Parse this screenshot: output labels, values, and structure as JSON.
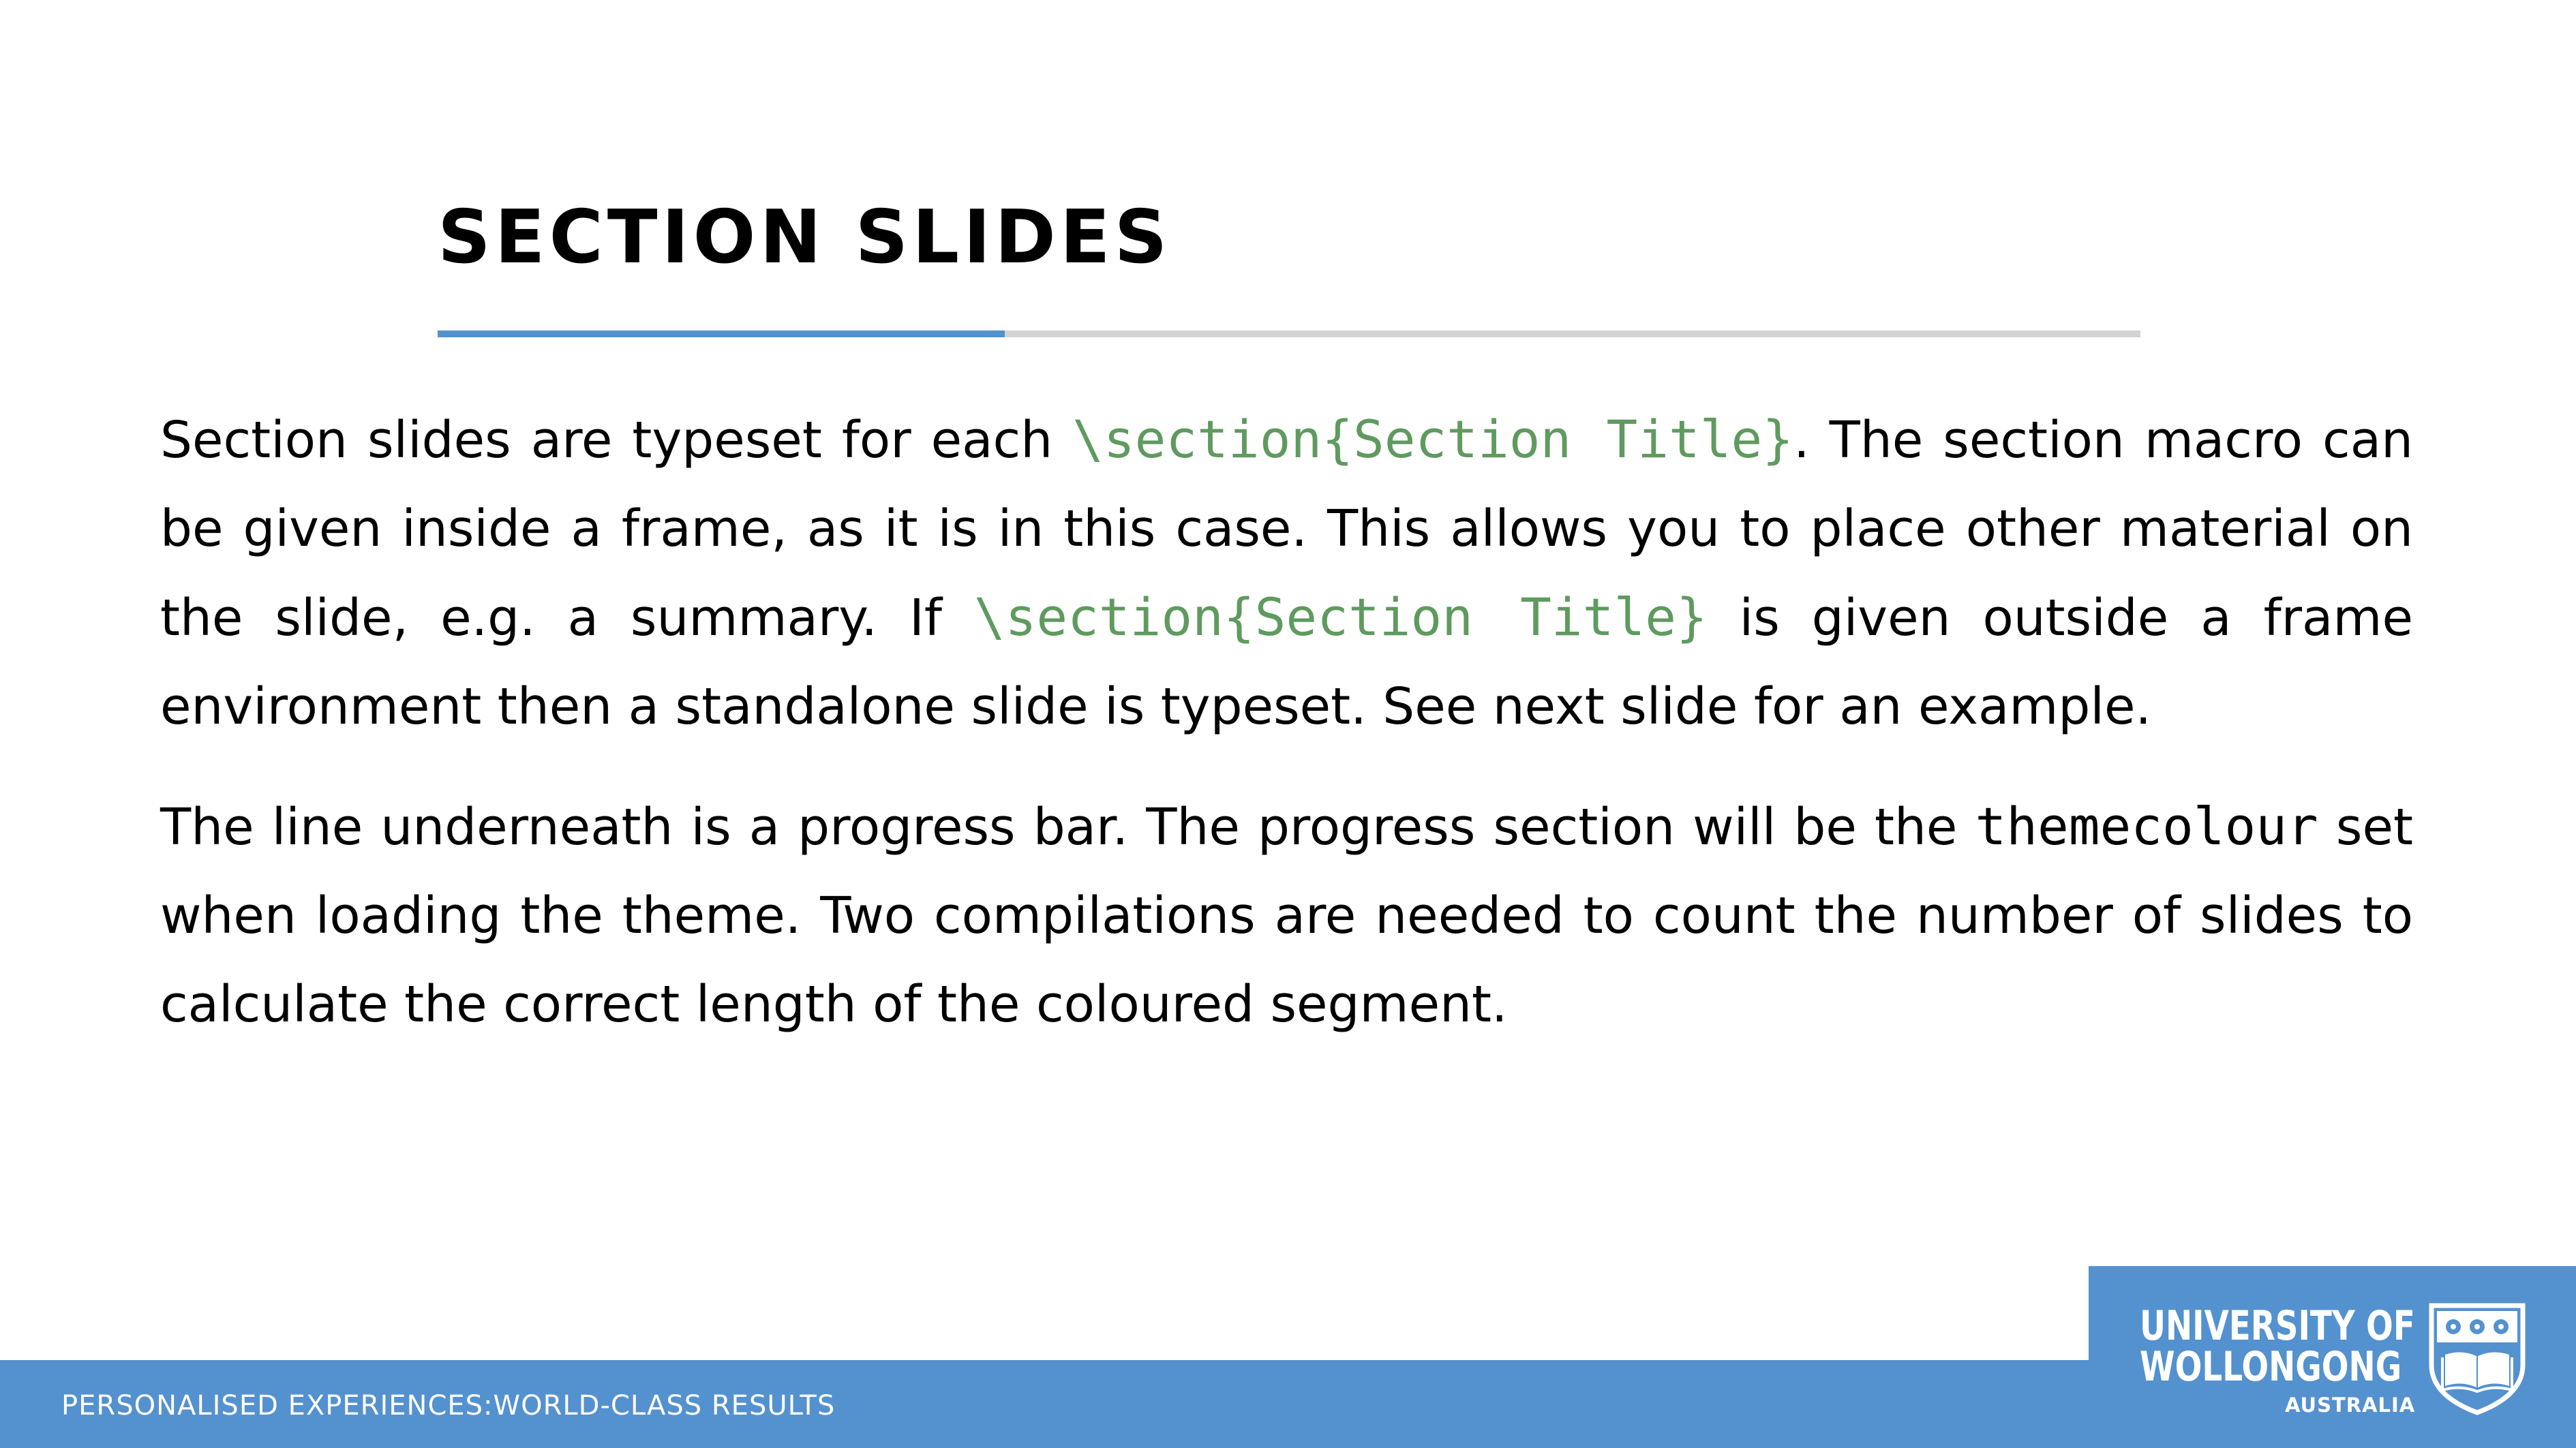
{
  "slide": {
    "title": "SECTION SLIDES",
    "progress_fraction": 0.333
  },
  "paragraphs": [
    {
      "segments": [
        {
          "t": "Section slides are typeset for each "
        },
        {
          "t": "\\section{Section Title}",
          "style": "code-green"
        },
        {
          "t": ". The section macro can be given inside a frame, as it is in this case. This allows you to place other material on the slide, e.g. a summary. If "
        },
        {
          "t": "\\section{Section Title}",
          "style": "code-green"
        },
        {
          "t": " is given outside a frame environment then a standalone slide is typeset. See next slide for an example."
        }
      ]
    },
    {
      "segments": [
        {
          "t": "The line underneath is a progress bar. The progress section will be the "
        },
        {
          "t": "themecolour",
          "style": "code-black"
        },
        {
          "t": " set when loading the theme. Two compilations are needed to count the number of slides to calculate the correct length of the coloured segment."
        }
      ]
    }
  ],
  "footer": {
    "tagline": "PERSONALISED EXPERIENCES:WORLD-CLASS RESULTS"
  },
  "logo": {
    "line1": "UNIVERSITY OF",
    "line2": "WOLLONGONG",
    "line3": "AUSTRALIA",
    "icon": "university-crest-icon"
  },
  "colors": {
    "theme": "#5491cf",
    "progress_track": "#d3d3d3",
    "code": "#5f9a5f"
  }
}
